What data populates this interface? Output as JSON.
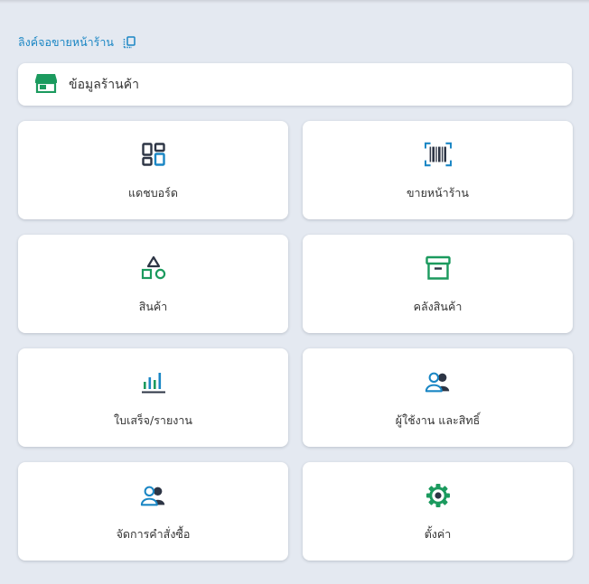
{
  "storefront_link": {
    "label": "ลิงค์จอขายหน้าร้าน",
    "icon": "copy-icon"
  },
  "store_info": {
    "label": "ข้อมูลร้านค้า",
    "icon": "store-icon"
  },
  "menu_tiles": [
    {
      "label": "แดชบอร์ด",
      "icon": "dashboard-icon"
    },
    {
      "label": "ขายหน้าร้าน",
      "icon": "barcode-scan-icon"
    },
    {
      "label": "สินค้า",
      "icon": "shapes-icon"
    },
    {
      "label": "คลังสินค้า",
      "icon": "archive-box-icon"
    },
    {
      "label": "ใบเสร็จ/รายงาน",
      "icon": "bar-chart-icon"
    },
    {
      "label": "ผู้ใช้งาน และสิทธิ์",
      "icon": "users-icon"
    },
    {
      "label": "จัดการคำสั่งซื้อ",
      "icon": "users-icon"
    },
    {
      "label": "ตั้งค่า",
      "icon": "gear-icon"
    }
  ],
  "colors": {
    "background": "#e4e9f1",
    "dark_icon": "#2d3545",
    "blue": "#1a86c4",
    "green": "#1b9a5e"
  }
}
